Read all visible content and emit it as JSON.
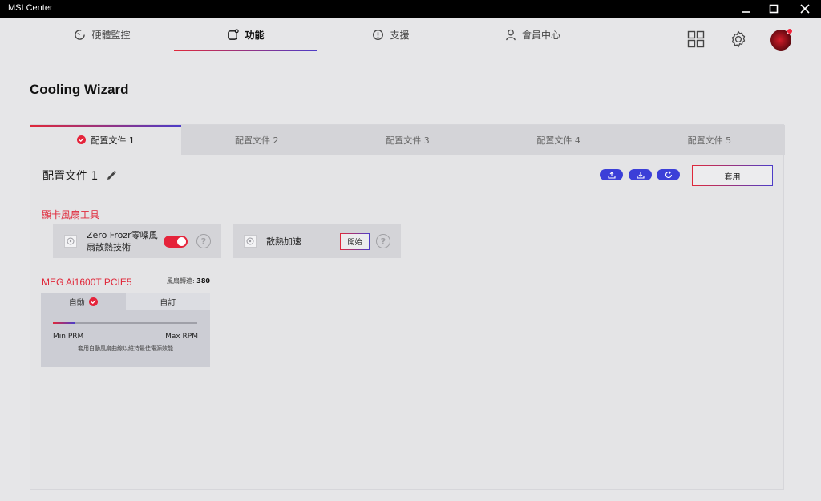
{
  "window": {
    "title": "MSI Center"
  },
  "nav": {
    "tabs": [
      {
        "label": "硬體監控",
        "icon": "gauge-icon"
      },
      {
        "label": "功能",
        "icon": "feature-icon"
      },
      {
        "label": "支援",
        "icon": "support-icon"
      },
      {
        "label": "會員中心",
        "icon": "user-icon"
      }
    ],
    "active_index": 1
  },
  "page": {
    "title": "Cooling Wizard"
  },
  "profiles": {
    "tabs": [
      "配置文件 1",
      "配置文件 2",
      "配置文件 3",
      "配置文件 4",
      "配置文件 5"
    ],
    "active_index": 0,
    "current_name": "配置文件 1",
    "apply_label": "套用"
  },
  "gpu_fan_tools": {
    "section_title": "顯卡風扇工具",
    "zero_frozr": {
      "label_line1": "Zero Frozr零噪風",
      "label_line2": "扇散熱技術",
      "enabled": true
    },
    "cooling_boost": {
      "label": "散熱加速",
      "button_label": "開始"
    }
  },
  "device": {
    "name": "MEG Ai1600T PCIE5",
    "fan_speed_label": "風扇轉速:",
    "fan_speed_value": "380",
    "modes": [
      "自動",
      "自訂"
    ],
    "active_mode": 0,
    "slider_fraction": 0.15,
    "min_label": "Min PRM",
    "max_label": "Max RPM",
    "description": "套用自動風扇曲線以維持最佳電源效能"
  },
  "colors": {
    "accent_red": "#e0283a",
    "accent_blue": "#4c3cc8",
    "button_blue": "#3b3fd8"
  }
}
